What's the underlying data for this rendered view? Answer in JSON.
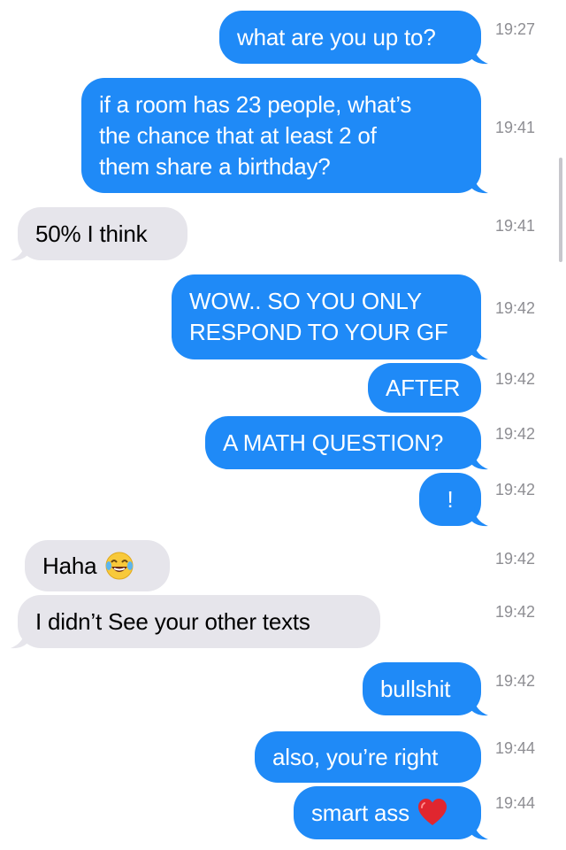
{
  "colors": {
    "sent": "#1f8af7",
    "received": "#e6e5eb",
    "timestamp": "#8e8e93"
  },
  "messages": [
    {
      "dir": "sent",
      "text": "what are you up to?",
      "time": "19:27"
    },
    {
      "dir": "sent",
      "text": "if a room has 23 people, what’s\nthe chance that at least 2 of\nthem share a birthday?",
      "time": "19:41"
    },
    {
      "dir": "received",
      "text": "50% I think",
      "time": "19:41"
    },
    {
      "dir": "sent",
      "text": "WOW.. SO YOU ONLY\nRESPOND TO YOUR GF",
      "time": "19:42"
    },
    {
      "dir": "sent",
      "text": "AFTER",
      "time": "19:42"
    },
    {
      "dir": "sent",
      "text": "A MATH QUESTION?",
      "time": "19:42"
    },
    {
      "dir": "sent",
      "text": "!",
      "time": "19:42"
    },
    {
      "dir": "received",
      "text": "Haha",
      "emoji": "tears-of-joy-emoji",
      "time": "19:42"
    },
    {
      "dir": "received",
      "text": "I didn’t See your other texts",
      "time": "19:42"
    },
    {
      "dir": "sent",
      "text": "bullshit",
      "time": "19:42"
    },
    {
      "dir": "sent",
      "text": "also, you’re right",
      "time": "19:44"
    },
    {
      "dir": "sent",
      "text": "smart ass",
      "emoji": "red-heart-emoji",
      "time": "19:44"
    }
  ]
}
